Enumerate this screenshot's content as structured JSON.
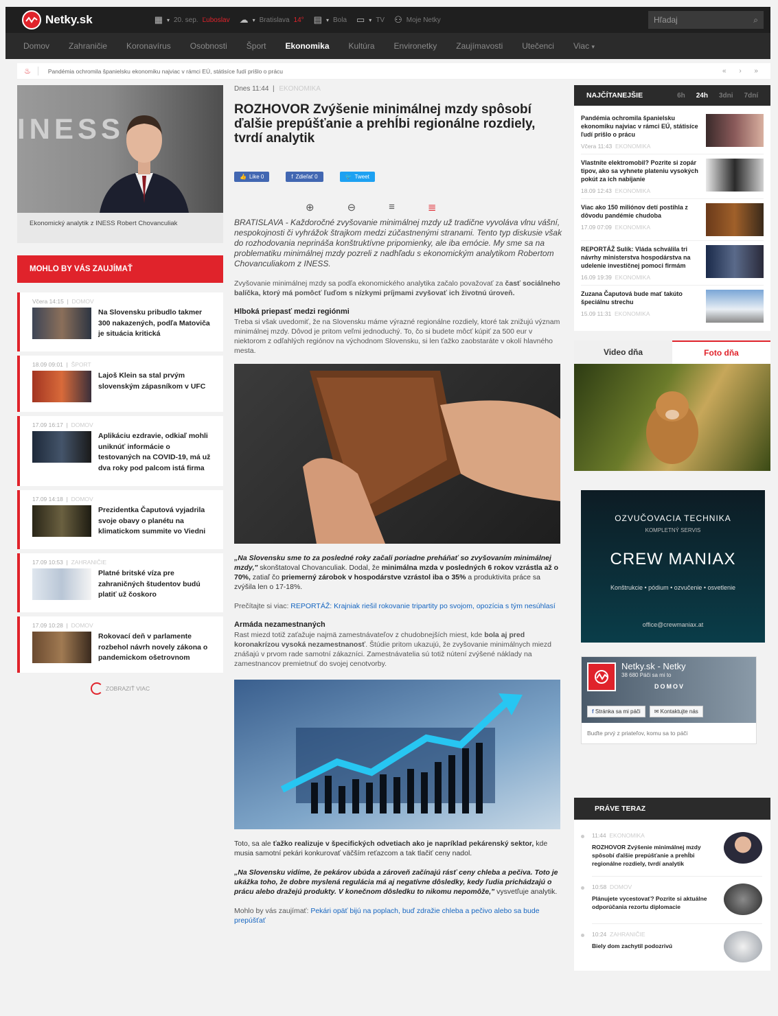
{
  "topbar": {
    "logo": "Netky.sk",
    "date": "20. sep.",
    "nameday": "Ľuboslav",
    "weather_city": "Bratislava",
    "weather_temp": "14°",
    "tv_label": "Bola",
    "tv2_label": "TV",
    "my_netky": "Moje Netky",
    "search_placeholder": "Hľadaj"
  },
  "nav": {
    "items": [
      "Domov",
      "Zahraničie",
      "Koronavírus",
      "Osobnosti",
      "Šport",
      "Ekonomika",
      "Kultúra",
      "Environetky",
      "Zaujímavosti",
      "Utečenci",
      "Viac"
    ],
    "active": "Ekonomika"
  },
  "ticker": {
    "text": "Pandémia ochromila španielsku ekonomiku najviac v rámci EÚ, státisíce ľudí prišlo o prácu",
    "controls": "« › »"
  },
  "hero": {
    "bg_text": "INESS",
    "caption": "Ekonomický analytik z INESS Robert Chovanculiak"
  },
  "mohlo": {
    "heading": "MOHLO BY VÁS ZAUJÍMAŤ",
    "items": [
      {
        "time": "Včera 14:15",
        "cat": "DOMOV",
        "title": "Na Slovensku pribudlo takmer 300 nakazených, podľa Matoviča je situácia kritická"
      },
      {
        "time": "18.09 09:01",
        "cat": "ŠPORT",
        "title": "Lajoš Klein sa stal prvým slovenským zápasníkom v UFC"
      },
      {
        "time": "17.09 16:17",
        "cat": "DOMOV",
        "title": "Aplikáciu ezdravie, odkiaľ mohli uniknúť informácie o testovaných na COVID-19, má už dva roky pod palcom istá firma"
      },
      {
        "time": "17.09 14:18",
        "cat": "DOMOV",
        "title": "Prezidentka Čaputová vyjadrila svoje obavy o planétu na klimatickom summite vo Viedni"
      },
      {
        "time": "17.09 10:53",
        "cat": "ZAHRANIČIE",
        "title": "Platné britské víza pre zahraničných študentov budú platiť už čoskoro"
      },
      {
        "time": "17.09 10:28",
        "cat": "DOMOV",
        "title": "Rokovací deň v parlamente rozbehol návrh novely zákona o pandemickom ošetrovnom"
      }
    ],
    "more": "ZOBRAZIŤ VIAC"
  },
  "article": {
    "time": "Dnes 11:44",
    "cat": "EKONOMIKA",
    "headline": "ROZHOVOR Zvýšenie minimálnej mzdy spôsobí ďalšie prepúšťanie a prehĺbi regionálne rozdiely, tvrdí analytik",
    "like": "Like 0",
    "share": "Zdieľať 0",
    "tweet": "Tweet",
    "perex": "BRATISLAVA - Každoročné zvyšovanie minimálnej mzdy už tradične vyvoláva vlnu vášní, nespokojnosti či vyhrážok štrajkom medzi zúčastnenými stranami. Tento typ diskusie však do rozhodovania neprináša konštruktívne pripomienky, ale iba emócie. My sme sa na problematiku minimálnej mzdy pozreli z nadhľadu s ekonomickým analytikom Robertom Chovanculiakom z INESS.",
    "p1a": "Zvyšovanie minimálnej mzdy sa podľa ekonomického analytika začalo považovať za ",
    "p1b": "časť sociálneho balíčka, ktorý má pomôcť ľuďom s nízkymi príjmami zvyšovať ich životnú úroveň.",
    "h1": "Hlboká priepasť medzi regiónmi",
    "p2": "Treba si však uvedomiť, že na Slovensku máme výrazné regionálne rozdiely, ktoré tak znižujú význam minimálnej mzdy. Dôvod je pritom veľmi jednoduchý. To, čo si budete môcť kúpiť za 500 eur v niektorom z odľahlých regiónov na východnom Slovensku, si len ťažko zaobstaráte v okolí hlavného mesta.",
    "q1a": "„Na Slovensku sme to za posledné roky začali poriadne preháňať so zvyšovaním minimálnej mzdy,\"",
    "q1b": " skonštatoval Chovanculiak. Dodal, že ",
    "q1c": "minimálna mzda v posledných 6 rokov vzrástla až o 70%,",
    "q1d": " zatiaľ čo ",
    "q1e": "priemerný zárobok v hospodárstve vzrástol iba o 35%",
    "q1f": " a produktivita práce sa zvýšila len o 17-18%.",
    "read_more_label": "Prečítajte si viac: ",
    "read_more_link": "REPORTÁŽ: Krajniak riešil rokovanie tripartity po svojom, opozícia s tým nesúhlasí",
    "h2": "Armáda nezamestnaných",
    "p3a": "Rast miezd totiž zaťažuje najmä zamestnávateľov z chudobnejších miest, kde ",
    "p3b": "bola aj pred koronakrízou vysoká nezamestnanosť",
    "p3c": ". Štúdie pritom ukazujú, že zvyšovanie minimálnych miezd znášajú v prvom rade samotní zákazníci. Zamestnávatelia sú totiž nútení zvýšené náklady na zamestnancov premietnuť do svojej cenotvorby.",
    "p4a": "Toto, sa ale ",
    "p4b": "ťažko realizuje v špecifických odvetiach ako je napríklad pekárenský sektor,",
    "p4c": " kde musia samotní pekári konkurovať väčším reťazcom a tak tlačiť ceny nadol.",
    "q2a": "„Na Slovensku vidíme, že pekárov ubúda a zároveň začínajú rásť ceny chleba a pečiva. Toto je ukážka toho, že dobre myslená regulácia má aj negatívne dôsledky, kedy ľudia prichádzajú o prácu alebo dražejú produkty. V konečnom dôsledku to nikomu nepomôže,\"",
    "q2b": " vysvetľuje analytik.",
    "mohlo_label": "Mohlo by vás zaujímať: ",
    "mohlo_link": "Pekári opäť bijú na poplach, buď zdražie chleba a pečivo alebo sa bude prepúšťať"
  },
  "najcitanejsie": {
    "heading": "NAJČÍTANEJŠIE",
    "tabs": [
      "6h",
      "24h",
      "3dni",
      "7dní"
    ],
    "active_tab": "24h",
    "items": [
      {
        "title": "Pandémia ochromila španielsku ekonomiku najviac v rámci EÚ, státisíce ľudí prišlo o prácu",
        "time": "Včera 11:43",
        "cat": "EKONOMIKA"
      },
      {
        "title": "Vlastníte elektromobil? Pozrite si zopár tipov, ako sa vyhnete plateniu vysokých pokút za ich nabíjanie",
        "time": "18.09 12:43",
        "cat": "EKONOMIKA"
      },
      {
        "title": "Viac ako 150 miliónov detí postihla z dôvodu pandémie chudoba",
        "time": "17.09 07:09",
        "cat": "EKONOMIKA"
      },
      {
        "title": "REPORTÁŽ Sulík: Vláda schválila tri návrhy ministerstva hospodárstva na udelenie investičnej pomoci firmám",
        "time": "16.09 19:39",
        "cat": "EKONOMIKA"
      },
      {
        "title": "Zuzana Čaputová bude mať takúto špeciálnu strechu",
        "time": "15.09 11:31",
        "cat": "EKONOMIKA"
      }
    ]
  },
  "media_tabs": {
    "video": "Video dňa",
    "foto": "Foto dňa"
  },
  "ad": {
    "line1": "OZVUČOVACIA TECHNIKA",
    "line2": "KOMPLETNÝ SERVIS",
    "brand": "CREW MANIAX",
    "line3": "Konštrukcie • pódium • ozvučenie • osvetlenie",
    "email": "office@crewmaniax.at"
  },
  "fb": {
    "name": "Netky.sk - Netky",
    "likes": "38 680 Páči sa mi to",
    "overlay": "DOMOV",
    "like_btn": "Stránka sa mi páči",
    "contact_btn": "Kontaktujte nás",
    "footer": "Buďte prvý z priateľov, komu sa to páči"
  },
  "prave_teraz": {
    "heading": "PRÁVE TERAZ",
    "items": [
      {
        "time": "11:44",
        "cat": "EKONOMIKA",
        "title": "ROZHOVOR Zvýšenie minimálnej mzdy spôsobí ďalšie prepúšťanie a prehĺbi regionálne rozdiely, tvrdí analytik"
      },
      {
        "time": "10:58",
        "cat": "DOMOV",
        "title": "Plánujete vycestovať? Pozrite si aktuálne odporúčania rezortu diplomacie"
      },
      {
        "time": "10:24",
        "cat": "ZAHRANIČIE",
        "title": "Biely dom zachytil podozrivú"
      }
    ]
  },
  "colors": {
    "accent": "#e0232b",
    "dark": "#1f1f1f",
    "link": "#1565c0"
  }
}
